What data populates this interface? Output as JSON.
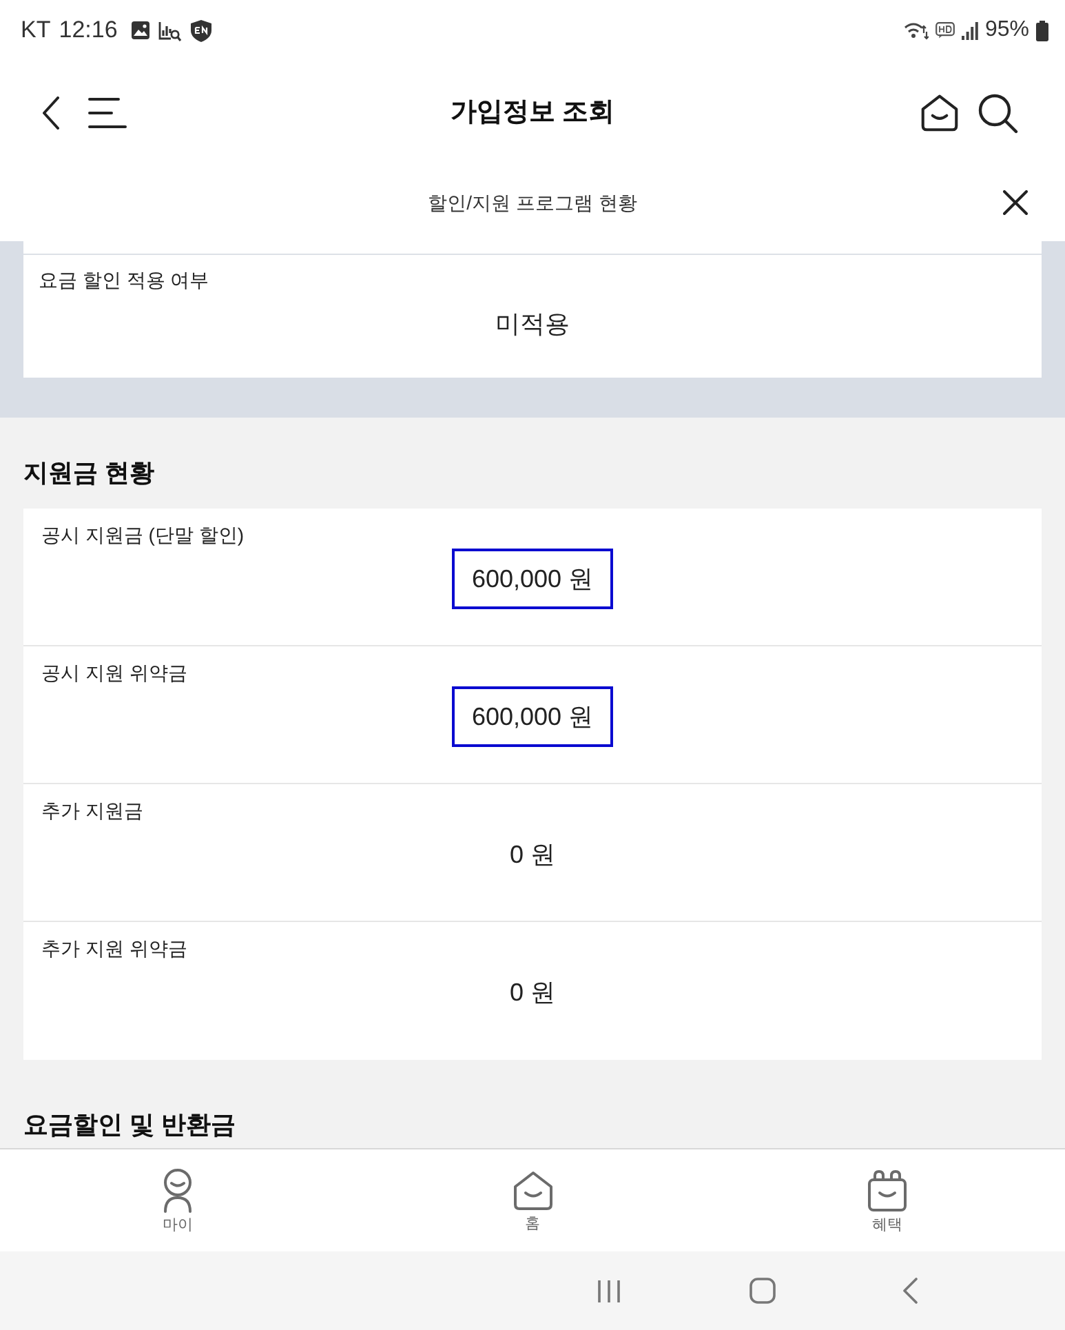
{
  "status_bar": {
    "carrier": "KT",
    "time": "12:16",
    "battery": "95%"
  },
  "header": {
    "title": "가입정보 조회"
  },
  "sub_header": {
    "title": "할인/지원 프로그램 현황"
  },
  "discount_card": {
    "rows": [
      {
        "label": "요금 할인 적용 여부",
        "value": "미적용",
        "highlighted": false
      }
    ]
  },
  "sections": [
    {
      "title": "지원금 현황",
      "rows": [
        {
          "label": "공시 지원금 (단말 할인)",
          "value": "600,000 원",
          "highlighted": true
        },
        {
          "label": "공시 지원 위약금",
          "value": "600,000 원",
          "highlighted": true
        },
        {
          "label": "추가 지원금",
          "value": "0 원",
          "highlighted": false
        },
        {
          "label": "추가 지원 위약금",
          "value": "0 원",
          "highlighted": false
        }
      ]
    },
    {
      "title": "요금할인 및 반환금"
    }
  ],
  "bottom_nav": {
    "items": [
      {
        "label": "마이",
        "kind": "person"
      },
      {
        "label": "홈",
        "kind": "home"
      },
      {
        "label": "혜택",
        "kind": "gift"
      }
    ]
  }
}
